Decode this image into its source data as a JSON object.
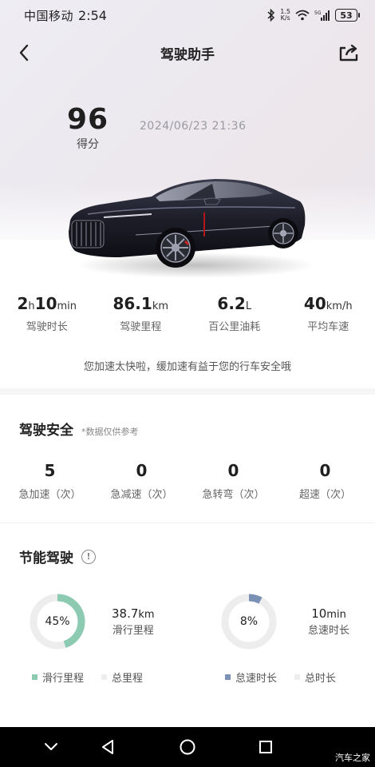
{
  "status_bar": {
    "carrier": "中国移动",
    "time": "2:54",
    "net_speed_value": "1.5",
    "net_speed_unit": "K/s",
    "battery": "53"
  },
  "header": {
    "title": "驾驶助手"
  },
  "score": {
    "value": "96",
    "label": "得分",
    "datetime": "2024/06/23  21:36"
  },
  "stats": [
    {
      "value_parts": [
        "2",
        "h",
        "10",
        "min"
      ],
      "label": "驾驶时长"
    },
    {
      "value_parts": [
        "86.1",
        "km"
      ],
      "label": "驾驶里程"
    },
    {
      "value_parts": [
        "6.2",
        "L"
      ],
      "label": "百公里油耗"
    },
    {
      "value_parts": [
        "40",
        "km/h"
      ],
      "label": "平均车速"
    }
  ],
  "tip": "您加速太快啦，缓加速有益于您的行车安全哦",
  "safety": {
    "title": "驾驶安全",
    "note": "*数据仅供参考",
    "items": [
      {
        "value": "5",
        "label": "急加速（次）"
      },
      {
        "value": "0",
        "label": "急减速（次）"
      },
      {
        "value": "0",
        "label": "急转弯（次）"
      },
      {
        "value": "0",
        "label": "超速（次）"
      }
    ]
  },
  "energy": {
    "title": "节能驾驶",
    "coast": {
      "percent": 45,
      "percent_label": "45%",
      "value": "38.7",
      "unit": "km",
      "label": "滑行里程",
      "color": "#8ccbb2",
      "legend": [
        "滑行里程",
        "总里程"
      ]
    },
    "idle": {
      "percent": 8,
      "percent_label": "8%",
      "value": "10",
      "unit": "min",
      "label": "怠速时长",
      "color": "#7a90b4",
      "legend": [
        "怠速时长",
        "总时长"
      ]
    },
    "track_color": "#ededee"
  },
  "watermark": "汽车之家"
}
